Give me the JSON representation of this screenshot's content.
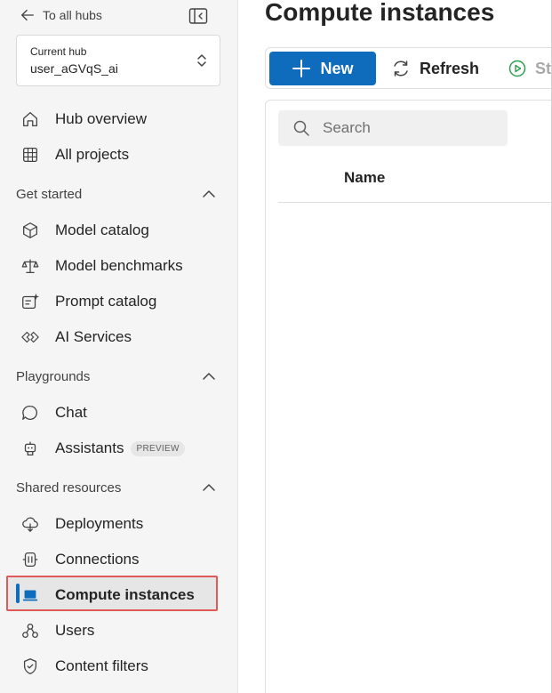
{
  "sidebar": {
    "back_label": "To all hubs",
    "hub": {
      "caption": "Current hub",
      "name": "user_aGVqS_ai"
    },
    "top_items": [
      {
        "label": "Hub overview",
        "icon": "home-icon"
      },
      {
        "label": "All projects",
        "icon": "grid-icon"
      }
    ],
    "sections": [
      {
        "title": "Get started",
        "items": [
          {
            "label": "Model catalog",
            "icon": "cube-icon"
          },
          {
            "label": "Model benchmarks",
            "icon": "scales-icon"
          },
          {
            "label": "Prompt catalog",
            "icon": "prompt-sparkle-icon"
          },
          {
            "label": "AI Services",
            "icon": "ai-services-icon"
          }
        ]
      },
      {
        "title": "Playgrounds",
        "items": [
          {
            "label": "Chat",
            "icon": "chat-icon"
          },
          {
            "label": "Assistants",
            "icon": "bot-icon",
            "badge": "PREVIEW"
          }
        ]
      },
      {
        "title": "Shared resources",
        "items": [
          {
            "label": "Deployments",
            "icon": "cloud-deploy-icon"
          },
          {
            "label": "Connections",
            "icon": "connections-icon"
          },
          {
            "label": "Compute instances",
            "icon": "laptop-icon",
            "active": true
          },
          {
            "label": "Users",
            "icon": "users-icon"
          },
          {
            "label": "Content filters",
            "icon": "shield-icon"
          }
        ]
      }
    ]
  },
  "main": {
    "title": "Compute instances",
    "toolbar": {
      "new_label": "New",
      "refresh_label": "Refresh",
      "start_label": "Start"
    },
    "search": {
      "placeholder": "Search"
    },
    "table": {
      "columns": [
        "Name"
      ]
    }
  },
  "colors": {
    "accent": "#0f6cbd",
    "highlight_border": "#e05a5a",
    "sidebar_bg": "#f5f5f5"
  }
}
